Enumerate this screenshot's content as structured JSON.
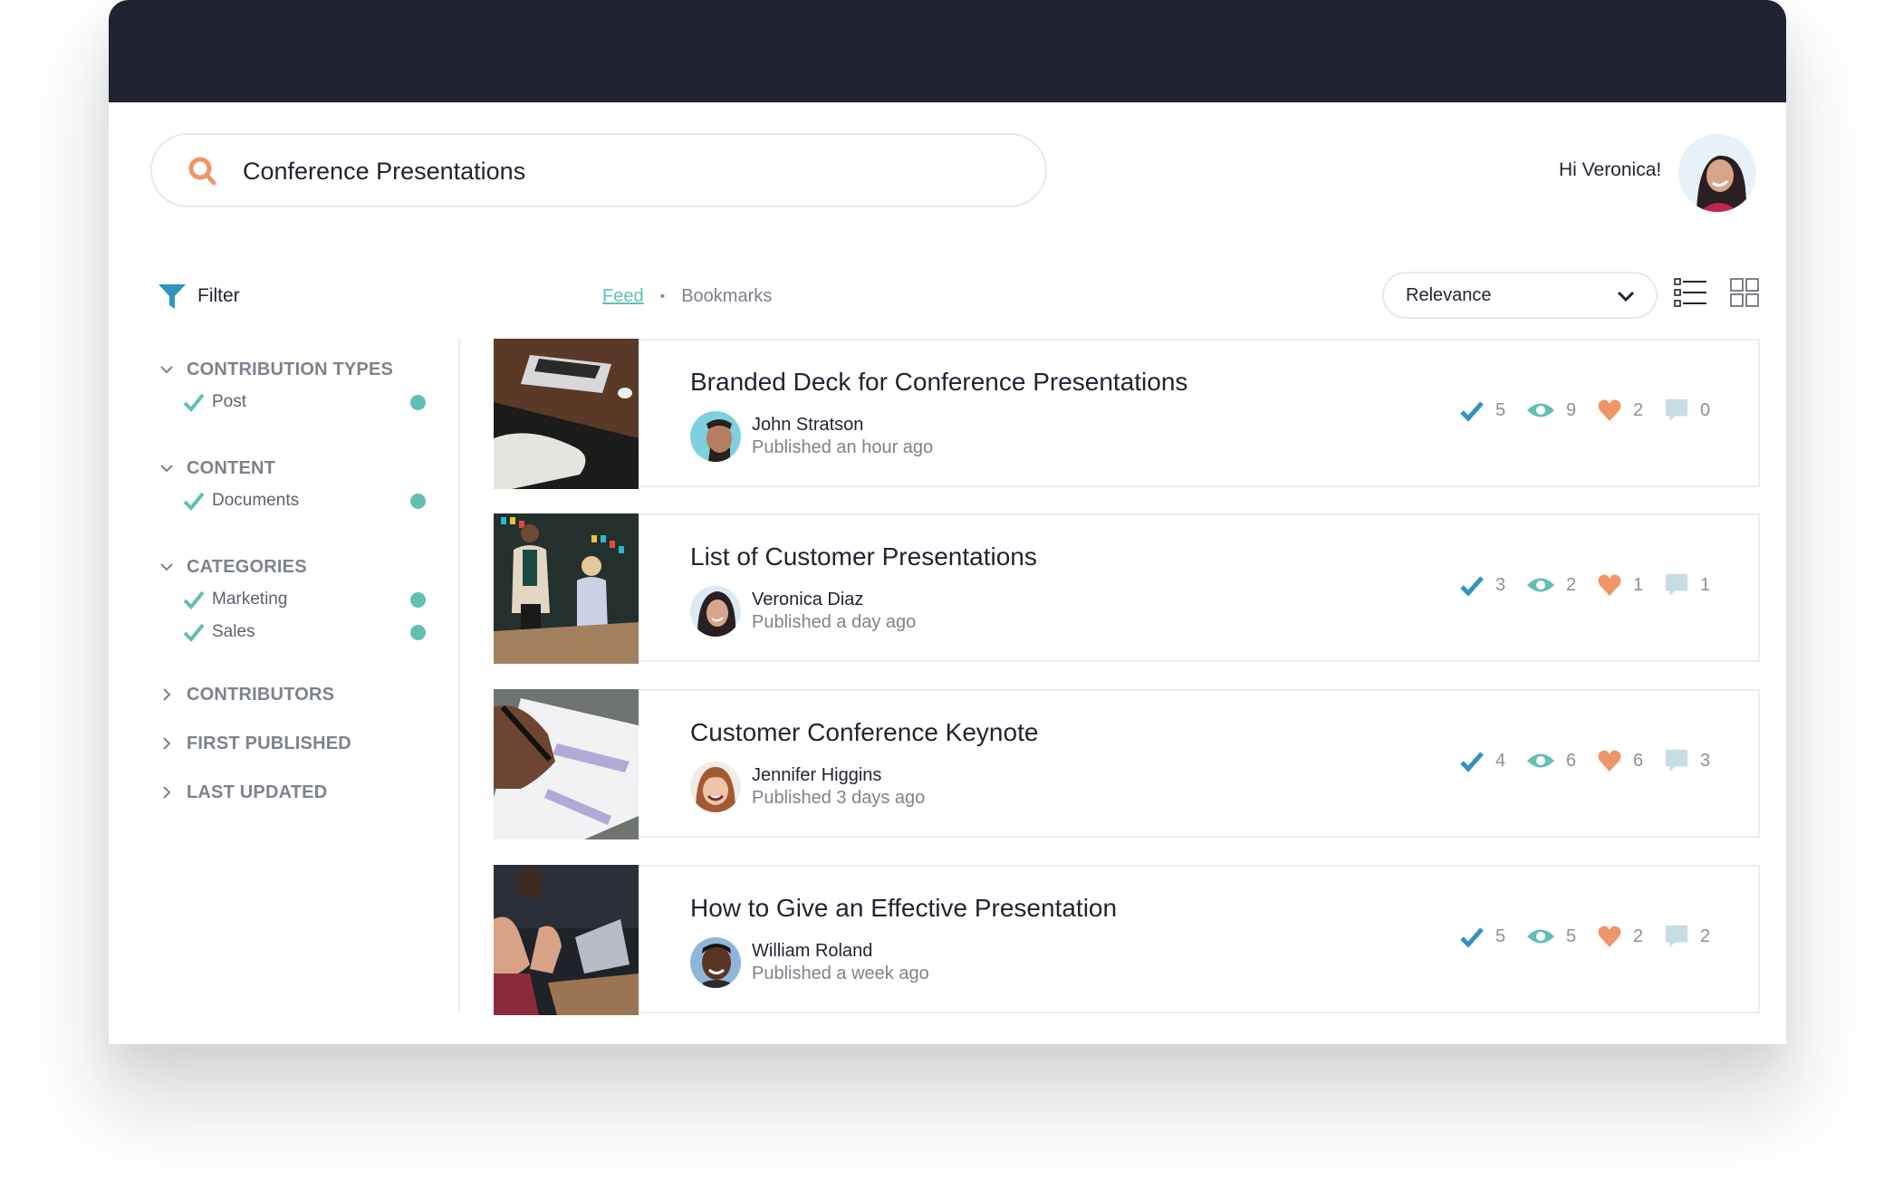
{
  "search": {
    "value": "Conference Presentations",
    "icon": "search-icon"
  },
  "user": {
    "greeting": "Hi Veronica!",
    "avatar": "avatar-veronica"
  },
  "filter": {
    "label": "Filter",
    "icon": "funnel-icon",
    "sections": [
      {
        "title": "CONTRIBUTION TYPES",
        "expanded": true,
        "options": [
          {
            "label": "Post",
            "checked": true
          }
        ]
      },
      {
        "title": "CONTENT",
        "expanded": true,
        "options": [
          {
            "label": "Documents",
            "checked": true
          }
        ]
      },
      {
        "title": "CATEGORIES",
        "expanded": true,
        "options": [
          {
            "label": "Marketing",
            "checked": true
          },
          {
            "label": "Sales",
            "checked": true
          }
        ]
      },
      {
        "title": "CONTRIBUTORS",
        "expanded": false,
        "options": []
      },
      {
        "title": "FIRST PUBLISHED",
        "expanded": false,
        "options": []
      },
      {
        "title": "LAST UPDATED",
        "expanded": false,
        "options": []
      }
    ]
  },
  "tabs": {
    "feed": "Feed",
    "separator": "•",
    "bookmarks": "Bookmarks",
    "active": "Feed"
  },
  "sort": {
    "selected": "Relevance"
  },
  "view": {
    "list_icon": "list-view-icon",
    "grid_icon": "grid-view-icon",
    "active": "list"
  },
  "colors": {
    "topbar": "#1f2430",
    "accent_teal": "#62bfb3",
    "check_blue": "#2f95bd",
    "heart_orange": "#f0956a",
    "comment_blue": "#c6dce6",
    "search_orange": "#f0956a"
  },
  "cards": [
    {
      "title": "Branded Deck for Conference Presentations",
      "author": "John Stratson",
      "published": "Published an hour ago",
      "stats": {
        "approvals": "5",
        "views": "9",
        "likes": "2",
        "comments": "0"
      }
    },
    {
      "title": "List of Customer Presentations",
      "author": "Veronica Diaz",
      "published": "Published a day ago",
      "stats": {
        "approvals": "3",
        "views": "2",
        "likes": "1",
        "comments": "1"
      }
    },
    {
      "title": "Customer Conference Keynote",
      "author": "Jennifer Higgins",
      "published": "Published 3 days ago",
      "stats": {
        "approvals": "4",
        "views": "6",
        "likes": "6",
        "comments": "3"
      }
    },
    {
      "title": "How to Give an Effective Presentation",
      "author": "William Roland",
      "published": "Published a week ago",
      "stats": {
        "approvals": "5",
        "views": "5",
        "likes": "2",
        "comments": "2"
      }
    }
  ]
}
